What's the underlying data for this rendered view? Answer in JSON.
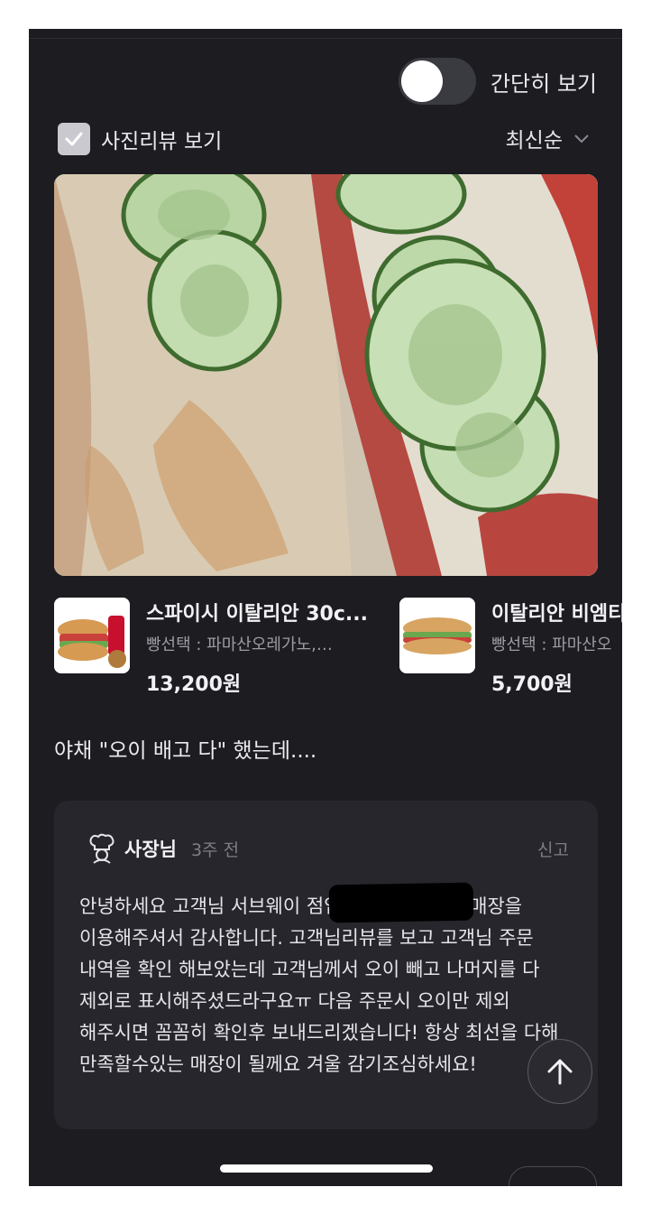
{
  "toggle": {
    "label": "간단히 보기",
    "on": false
  },
  "filter": {
    "photo_review_label": "사진리뷰 보기",
    "checked": true
  },
  "sort": {
    "label": "최신순"
  },
  "products": [
    {
      "name": "스파이시 이탈리안 30c...",
      "options": "빵선택 : 파마산오레가노,…",
      "price": "13,200원"
    },
    {
      "name": "이탈리안 비엠티",
      "options": "빵선택 : 파마산오",
      "price": "5,700원"
    }
  ],
  "review": {
    "text": "야채 \"오이 배고 다\" 했는데...."
  },
  "owner_reply": {
    "name": "사장님",
    "time": "3주 전",
    "report": "신고",
    "body": "안녕하세요 고객님 서브웨이 점입니다. 우선 저희 매장을 이용해주셔서 감사합니다. 고객님리뷰를 보고 고객님 주문 내역을 확인 해보았는데 고객님께서 오이 빼고 나머지를 다 제외로 표시해주셨드라구요ㅠ 다음 주문시 오이만 제외 해주시면 꼼꼼히 확인후 보내드리겠습니다! 항상 최선을 다해 만족할수있는 매장이 될께요 겨울 감기조심하세요!"
  },
  "colors": {
    "background": "#1c1c21",
    "card": "#26262c",
    "text": "#ebebef",
    "muted": "#7d7d86"
  }
}
